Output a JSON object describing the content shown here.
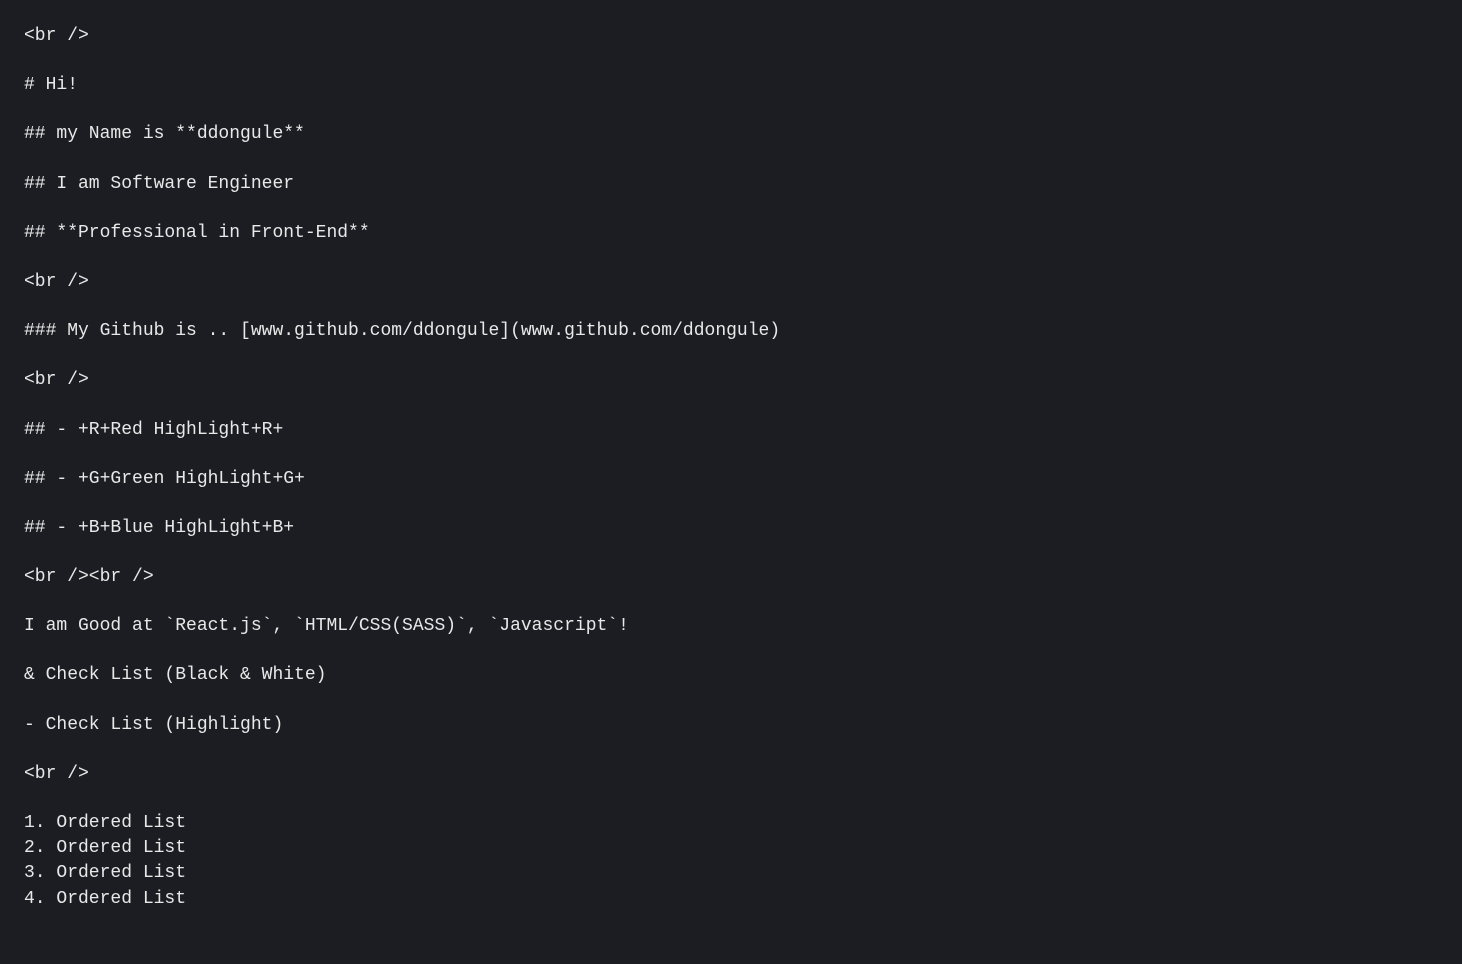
{
  "lines": {
    "l1": "<br />",
    "l2": "# Hi!",
    "l3": "## my Name is **ddongule**",
    "l4": "## I am Software Engineer",
    "l5": "## **Professional in Front-End**",
    "l6": "<br />",
    "l7": "### My Github is .. [www.github.com/ddongule](www.github.com/ddongule)",
    "l8": "<br />",
    "l9": "## - +R+Red HighLight+R+",
    "l10": "## - +G+Green HighLight+G+",
    "l11": "## - +B+Blue HighLight+B+",
    "l12": "<br /><br />",
    "l13": "I am Good at `React.js`, `HTML/CSS(SASS)`, `Javascript`!",
    "l14": "& Check List (Black & White)",
    "l15": "- Check List (Highlight)",
    "l16": "<br />",
    "l17": "1. Ordered List",
    "l18": "2. Ordered List",
    "l19": "3. Ordered List",
    "l20": "4. Ordered List"
  }
}
